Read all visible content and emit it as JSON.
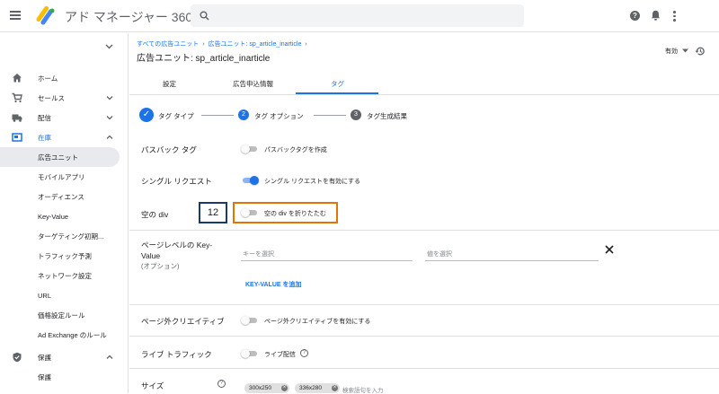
{
  "app": {
    "title": "アド マネージャー 360"
  },
  "sidebar": {
    "items": [
      {
        "label": "ホーム",
        "icon": "home-icon"
      },
      {
        "label": "セールス",
        "icon": "cart-icon"
      },
      {
        "label": "配信",
        "icon": "truck-icon"
      },
      {
        "label": "在庫",
        "icon": "inventory-icon"
      },
      {
        "label": "保護",
        "icon": "shield-icon"
      }
    ],
    "inventory_subitems": [
      "広告ユニット",
      "モバイルアプリ",
      "オーディエンス",
      "Key-Value",
      "ターゲティング初期...",
      "トラフィック予測",
      "ネットワーク設定",
      "URL",
      "価格設定ルール",
      "Ad Exchange のルール"
    ],
    "protection_subitems": [
      "保護"
    ]
  },
  "breadcrumb": {
    "root": "すべての広告ユニット",
    "sep": "›",
    "current": "広告ユニット: sp_article_inarticle"
  },
  "page_title": "広告ユニット: sp_article_inarticle",
  "status_dropdown": "有効",
  "tabs": [
    "設定",
    "広告申込情報",
    "タグ"
  ],
  "stepper": {
    "steps": [
      {
        "num": "✓",
        "label": "タグ タイプ"
      },
      {
        "num": "2",
        "label": "タグ オプション"
      },
      {
        "num": "3",
        "label": "タグ生成結果"
      }
    ]
  },
  "form": {
    "passback": {
      "label": "パスバック タグ",
      "toggle_label": "パスバックタグを作成"
    },
    "single_request": {
      "label": "シングル リクエスト",
      "toggle_label": "シングル リクエストを有効にする"
    },
    "empty_div": {
      "label": "空の div",
      "toggle_label": "空の div を折りたたむ",
      "annotation": "12"
    },
    "page_kv": {
      "label_line1": "ページレベルの Key-",
      "label_line2": "Value",
      "label_optional": "(オプション)",
      "key_placeholder": "キーを選択",
      "value_placeholder": "値を選択",
      "add_label": "KEY-VALUE を追加"
    },
    "out_of_page": {
      "label": "ページ外クリエイティブ",
      "toggle_label": "ページ外クリエイティブを有効にする"
    },
    "live_traffic": {
      "label": "ライブ トラフィック",
      "toggle_label": "ライブ配信"
    },
    "sizes": {
      "label": "サイズ",
      "chips": [
        "300x250",
        "336x280"
      ],
      "search_placeholder": "検索語句を入力"
    }
  },
  "colors": {
    "accent": "#1a73e8",
    "highlight_border": "#e37400",
    "annotation_border": "#1a3a6e"
  }
}
